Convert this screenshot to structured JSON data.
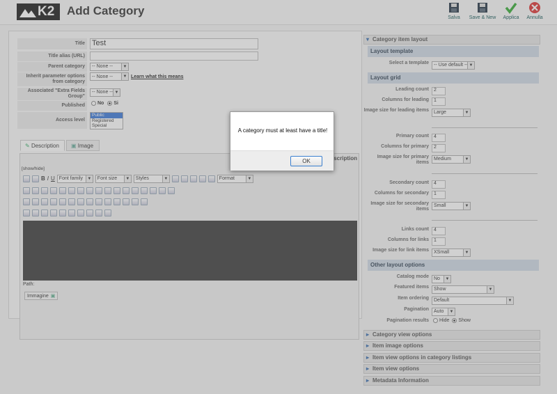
{
  "header": {
    "logo": "K2",
    "title": "Add Category",
    "toolbar": {
      "save": "Salva",
      "save_new": "Save & New",
      "apply": "Applica",
      "cancel": "Annulla"
    }
  },
  "form": {
    "title_label": "Title",
    "title_value": "Test",
    "alias_label": "Title alias (URL)",
    "alias_value": "",
    "parent_label": "Parent category",
    "parent_value": "-- None --",
    "inherit_label": "Inherit parameter options from category",
    "inherit_value": "-- None --",
    "inherit_link": "Learn what this means",
    "extra_label": "Associated \"Extra Fields Group\"",
    "extra_value": "-- None --",
    "published_label": "Published",
    "published_no": "No",
    "published_yes": "Si",
    "access_label": "Access level",
    "access_options": [
      "Public",
      "Registered",
      "Special"
    ]
  },
  "tabs": {
    "description": "Description",
    "image": "Image"
  },
  "editor": {
    "show_hide": "[show/hide]",
    "desc_tab": "Description",
    "font_family": "Font family",
    "font_size": "Font size",
    "styles": "Styles",
    "format": "Format",
    "path_label": "Path:",
    "image_button": "Immagine"
  },
  "right": {
    "layout_header": "Category item layout",
    "layout_template_head": "Layout template",
    "select_template_label": "Select a template",
    "select_template_value": "-- Use default --",
    "layout_grid_head": "Layout grid",
    "leading_count_label": "Leading count",
    "leading_count": "2",
    "cols_leading_label": "Columns for leading",
    "cols_leading": "1",
    "img_leading_label": "Image size for leading items",
    "img_leading": "Large",
    "primary_count_label": "Primary count",
    "primary_count": "4",
    "cols_primary_label": "Columns for primary",
    "cols_primary": "2",
    "img_primary_label": "Image size for primary items",
    "img_primary": "Medium",
    "secondary_count_label": "Secondary count",
    "secondary_count": "4",
    "cols_secondary_label": "Columns for secondary",
    "cols_secondary": "1",
    "img_secondary_label": "Image size for secondary items",
    "img_secondary": "Small",
    "links_count_label": "Links count",
    "links_count": "4",
    "cols_links_label": "Columns for links",
    "cols_links": "1",
    "img_links_label": "Image size for link items",
    "img_links": "XSmall",
    "other_head": "Other layout options",
    "catalog_label": "Catalog mode",
    "catalog_value": "No",
    "featured_label": "Featured items",
    "featured_value": "Show",
    "ordering_label": "Item ordering",
    "ordering_value": "Default",
    "pagination_label": "Pagination",
    "pagination_value": "Auto",
    "pag_results_label": "Pagination results",
    "pag_hide": "Hide",
    "pag_show": "Show",
    "acc_category_view": "Category view options",
    "acc_item_image": "Item image options",
    "acc_item_listings": "Item view options in category listings",
    "acc_item_view": "Item view options",
    "acc_metadata": "Metadata Information"
  },
  "dialog": {
    "message": "A category must at least have a title!",
    "ok": "OK"
  }
}
